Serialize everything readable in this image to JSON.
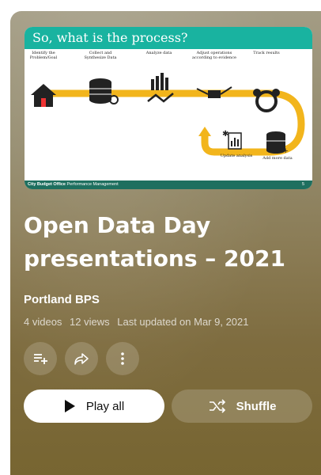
{
  "playlist": {
    "title": "Open Data Day presentations – 2021",
    "channel": "Portland BPS",
    "video_count": "4 videos",
    "views": "12 views",
    "updated": "Last updated on Mar 9, 2021"
  },
  "thumbnail": {
    "heading": "So, what is the process?",
    "steps": [
      "Identify the Problem/Goal",
      "Collect and Synthesize Data",
      "Analyze data",
      "Adjust operations according to evidence",
      "Track results",
      "Update analysis",
      "Add more data"
    ],
    "footer_org": "City Budget Office",
    "footer_team": "Performance Management",
    "slide_number": "5"
  },
  "actions": {
    "play_all": "Play all",
    "shuffle": "Shuffle"
  },
  "icons": [
    "save-to-playlist-icon",
    "share-icon",
    "more-options-icon",
    "play-icon",
    "shuffle-icon"
  ],
  "colors": {
    "slide_header": "#19b3a0",
    "arrow": "#f2b51c",
    "footer": "#1e6f5f"
  }
}
